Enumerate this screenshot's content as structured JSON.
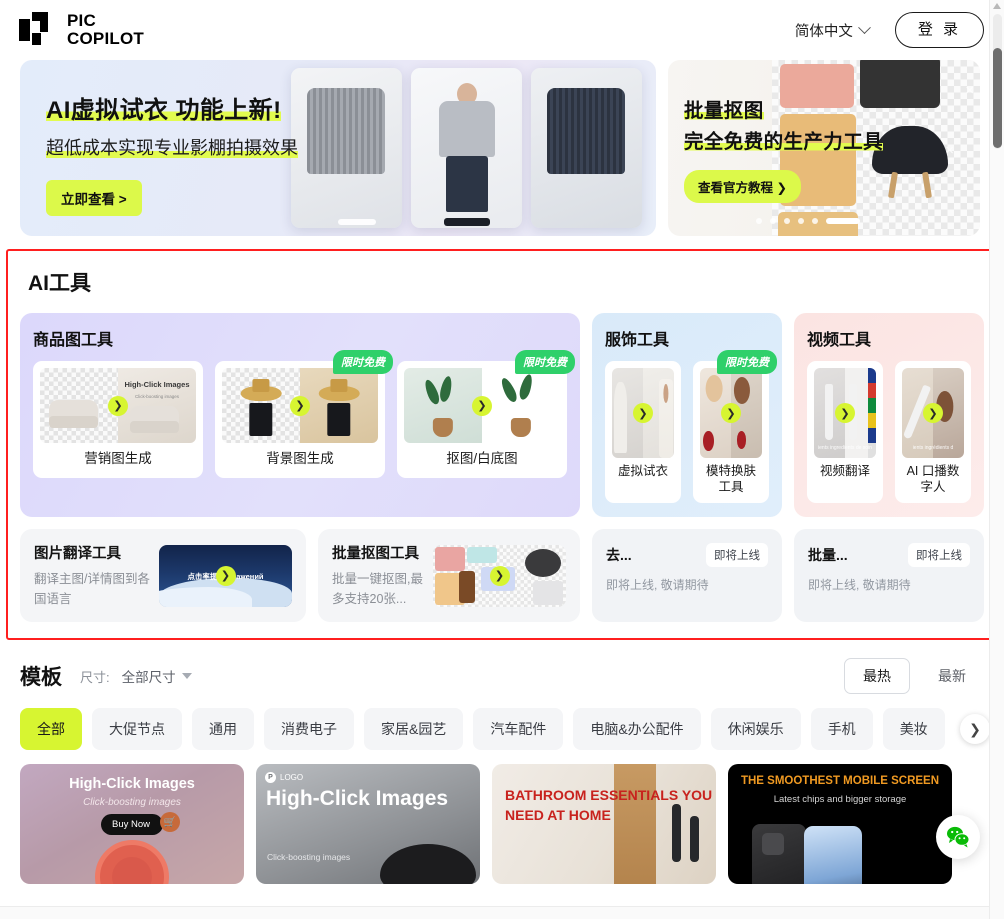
{
  "header": {
    "brand_line1": "PIC",
    "brand_line2": "COPILOT",
    "language": "简体中文",
    "login": "登 录"
  },
  "banners": [
    {
      "title": "AI虚拟试衣 功能上新!",
      "subtitle": "超低成本实现专业影棚拍摄效果",
      "cta": "立即查看 >"
    },
    {
      "title": "批量抠图",
      "title2": "完全免费的生产力工具",
      "cta": "查看官方教程 ❯"
    }
  ],
  "ai_tools": {
    "section_title": "AI工具",
    "groups": [
      {
        "name": "商品图工具",
        "tiles": [
          {
            "label": "营销图生成",
            "badge": "",
            "overlay_title": "High-Click Images",
            "overlay_sub": "Click-boosting images"
          },
          {
            "label": "背景图生成",
            "badge": "限时免费"
          },
          {
            "label": "抠图/白底图",
            "badge": "限时免费"
          }
        ]
      },
      {
        "name": "服饰工具",
        "tiles": [
          {
            "label": "虚拟试衣",
            "badge": ""
          },
          {
            "label": "模特换肤工具",
            "badge": "限时免费"
          }
        ]
      },
      {
        "name": "视频工具",
        "tiles": [
          {
            "label": "视频翻译",
            "badge": "",
            "caption": "ients ingredients de soin"
          },
          {
            "label": "AI 口播数字人",
            "badge": "",
            "caption": "ients ingrédients d"
          }
        ]
      }
    ],
    "row2": [
      {
        "title": "图片翻译工具",
        "desc": "翻译主图/详情图到各国语言",
        "img_text": "点击率提升 бражений"
      },
      {
        "title": "批量抠图工具",
        "desc": "批量一键抠图,最多支持20张..."
      }
    ],
    "coming_soon": [
      {
        "title": "去...",
        "badge": "即将上线",
        "desc": "即将上线, 敬请期待"
      },
      {
        "title": "批量...",
        "badge": "即将上线",
        "desc": "即将上线, 敬请期待"
      }
    ]
  },
  "templates": {
    "title": "模板",
    "size_label": "尺寸:",
    "size_value": "全部尺寸",
    "sort": {
      "hot": "最热",
      "new": "最新"
    },
    "chips": [
      "全部",
      "大促节点",
      "通用",
      "消费电子",
      "家居&园艺",
      "汽车配件",
      "电脑&办公配件",
      "休闲娱乐",
      "手机",
      "美妆"
    ],
    "cards": [
      {
        "heading": "High-Click Images",
        "sub": "Click-boosting images",
        "button": "Buy Now"
      },
      {
        "logo": "LOGO",
        "heading": "High-Click Images",
        "sub": "Click-boosting images"
      },
      {
        "heading": "BATHROOM ESSENTIALS YOU NEED AT HOME"
      },
      {
        "heading": "THE SMOOTHEST MOBILE SCREEN",
        "sub": "Latest chips and bigger storage"
      }
    ]
  },
  "float": {
    "wechat": "wechat-icon"
  },
  "colors": {
    "accent": "#d7f531",
    "free_badge": "#2fd06a",
    "outline": "#ff1f1f"
  }
}
